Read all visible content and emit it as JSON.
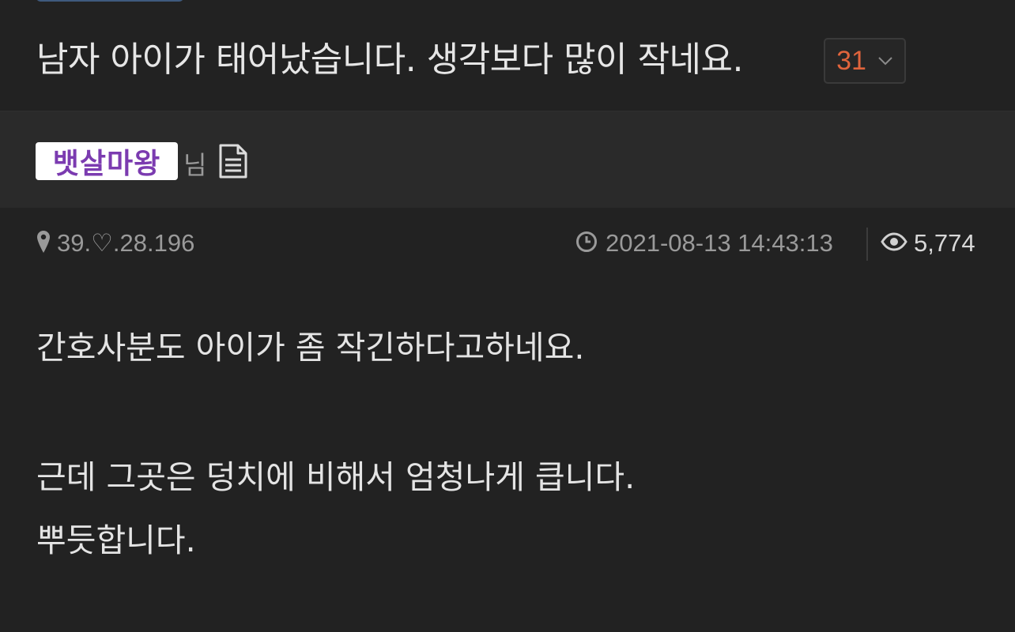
{
  "post": {
    "title": "남자 아이가 태어났습니다. 생각보다 많이 작네요.",
    "comment_count": "31",
    "comment_toggle_icon": "chevron-down-icon"
  },
  "author": {
    "nickname": "뱃살마왕",
    "nickname_color": "#7b3bb0",
    "honorific": "님",
    "posts_icon": "document-icon"
  },
  "meta": {
    "ip": "39.♡.28.196",
    "ip_icon": "map-pin-icon",
    "datetime": "2021-08-13 14:43:13",
    "datetime_icon": "clock-icon",
    "views": "5,774",
    "views_icon": "eye-icon"
  },
  "content": {
    "paragraphs": [
      "간호사분도 아이가 좀 작긴하다고하네요.",
      "",
      "근데 그곳은 덩치에 비해서 엄청나게 큽니다.",
      "뿌듯합니다."
    ]
  },
  "colors": {
    "background": "#222222",
    "author_bar": "#2a2a2a",
    "comment_count": "#e0643c",
    "text": "#e4e4e4",
    "muted": "#9a9a9a"
  }
}
